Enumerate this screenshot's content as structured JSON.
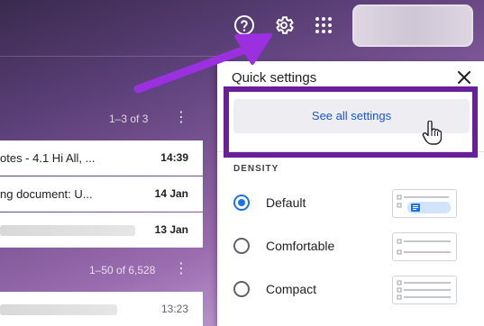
{
  "topbar": {
    "help_icon": "help-circle-icon",
    "settings_icon": "gear-icon",
    "apps_icon": "apps-grid-icon"
  },
  "inbox": {
    "sections": [
      {
        "count_label": "1–3 of 3"
      },
      {
        "count_label": "1–50 of 6,528"
      }
    ],
    "rows": [
      {
        "subject": "otes - 4.1 Hi All, ...",
        "date": "14:39",
        "unread": true
      },
      {
        "subject": "ng document: U...",
        "date": "14 Jan",
        "unread": true
      },
      {
        "subject": "",
        "date": "13 Jan",
        "unread": true
      },
      {
        "subject": "",
        "date": "13:23",
        "unread": false
      }
    ]
  },
  "quick_settings": {
    "title": "Quick settings",
    "close_icon": "close-icon",
    "see_all_label": "See all settings",
    "density": {
      "heading": "DENSITY",
      "options": [
        {
          "label": "Default",
          "selected": true
        },
        {
          "label": "Comfortable",
          "selected": false
        },
        {
          "label": "Compact",
          "selected": false
        }
      ]
    }
  },
  "colors": {
    "accent_blue": "#1a73e8",
    "highlight_purple": "#6a1f9a",
    "arrow_purple": "#9b30e0"
  }
}
